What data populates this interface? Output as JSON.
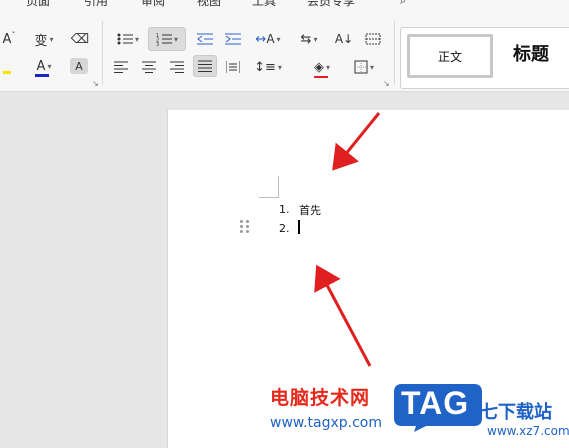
{
  "menubar": {
    "items": [
      "页面",
      "引用",
      "审阅",
      "视图",
      "工具",
      "会员专享"
    ]
  },
  "ribbon": {
    "font_color_letter": "A",
    "highlight_letter": "A",
    "shading_letter": "A",
    "text_direction_letter": "A",
    "phonetic_char": "变",
    "clear_letter": "A",
    "styles": {
      "normal": "正文",
      "heading": "标题"
    }
  },
  "document": {
    "list": [
      {
        "number": "1.",
        "text": "首先"
      },
      {
        "number": "2.",
        "text": ""
      }
    ]
  },
  "watermark": {
    "site_name_cn": "电脑技术网",
    "site_url": "www.tagxp.com",
    "logo_text": "TAG",
    "partner_cn": "七下载站",
    "partner_url": "www.xz7.com"
  },
  "colors": {
    "accent_red": "#e02020",
    "logo_blue": "#1f63c6"
  }
}
